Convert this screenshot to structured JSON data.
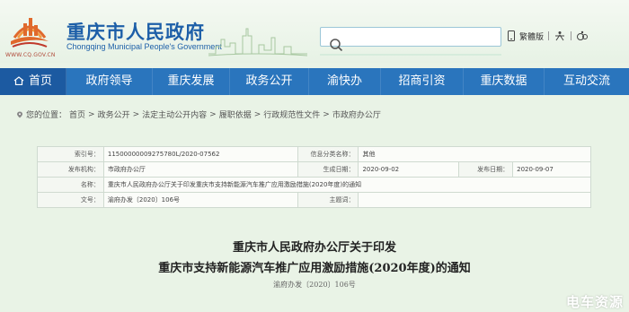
{
  "header": {
    "site_title": "重庆市人民政府",
    "site_subtitle": "Chongqing Municipal People's Government",
    "site_url": "WWW.CQ.GOV.CN",
    "search_placeholder": "",
    "tools": {
      "traditional_label": "繁體版"
    }
  },
  "nav": {
    "items": [
      {
        "label": "首页"
      },
      {
        "label": "政府领导"
      },
      {
        "label": "重庆发展"
      },
      {
        "label": "政务公开"
      },
      {
        "label": "渝快办"
      },
      {
        "label": "招商引资"
      },
      {
        "label": "重庆数据"
      },
      {
        "label": "互动交流"
      }
    ]
  },
  "breadcrumb": {
    "prefix": "您的位置：",
    "items": [
      "首页",
      "政务公开",
      "法定主动公开内容",
      "履职依据",
      "行政规范性文件",
      "市政府办公厅"
    ],
    "separator": ">"
  },
  "info": {
    "index_label": "索引号：",
    "index_value": "11500000009275780L/2020-07562",
    "category_label": "信息分类名称：",
    "category_value": "其他",
    "issuer_label": "发布机构：",
    "issuer_value": "市政府办公厅",
    "created_label": "生成日期：",
    "created_value": "2020-09-02",
    "published_label": "发布日期：",
    "published_value": "2020-09-07",
    "name_label": "名称：",
    "name_value": "重庆市人民政府办公厅关于印发重庆市支持新能源汽车推广应用激励措施(2020年度)的通知",
    "docno_label": "文号：",
    "docno_value": "渝府办发〔2020〕106号",
    "keywords_label": "主题词：",
    "keywords_value": ""
  },
  "document": {
    "title_line1": "重庆市人民政府办公厅关于印发",
    "title_line2": "重庆市支持新能源汽车推广应用激励措施(2020年度)的通知",
    "doc_number": "渝府办发〔2020〕106号"
  },
  "watermark": "电车资源",
  "colors": {
    "nav_bg": "#2a75bd",
    "nav_active": "#1c5aa1",
    "title_blue": "#1d5fa8",
    "page_bg": "#e9f3e6"
  }
}
